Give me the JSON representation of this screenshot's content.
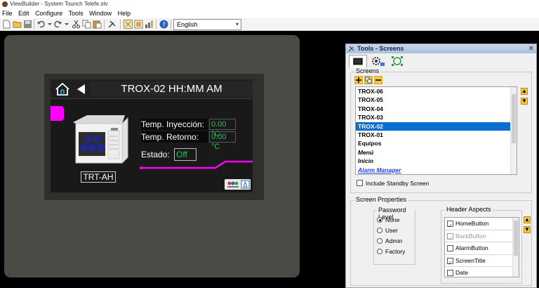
{
  "window": {
    "title": "ViewBuilder - System Tounch Telefe.stv"
  },
  "menu": [
    "File",
    "Edit",
    "Configure",
    "Tools",
    "Window",
    "Help"
  ],
  "toolbar": {
    "icons": [
      "new-file-icon",
      "open-folder-icon",
      "save-icon",
      "undo-icon",
      "redo-icon",
      "cut-icon",
      "copy-icon",
      "paste-icon",
      "tools-icon",
      "screen-layout-icon",
      "image-icon",
      "chart-icon",
      "help-icon"
    ],
    "language": "English"
  },
  "hmi": {
    "title": "TROX-02 HH:MM AM",
    "machine_label": "TRT-AH",
    "temp_inyeccion_label": "Temp. Inyección:",
    "temp_inyeccion_value": "0.00 °C",
    "temp_retorno_label": "Temp. Retorno:",
    "temp_retorno_value": "0.00 °C",
    "estado_label": "Estado:",
    "estado_value": "Off",
    "accent_color": "#ff00ff",
    "value_color": "#22c55e"
  },
  "tools": {
    "title": "Tools - Screens",
    "screens_group_title": "Screens",
    "screens": [
      {
        "name": "TROX-06",
        "style": "normal"
      },
      {
        "name": "TROX-05",
        "style": "normal"
      },
      {
        "name": "TROX-04",
        "style": "normal"
      },
      {
        "name": "TROX-03",
        "style": "normal"
      },
      {
        "name": "TROX-02",
        "style": "selected"
      },
      {
        "name": "TROX-01",
        "style": "normal"
      },
      {
        "name": "Equipos",
        "style": "normal"
      },
      {
        "name": "Menú",
        "style": "italic"
      },
      {
        "name": "Inicio",
        "style": "italic"
      },
      {
        "name": "Alarm Manager",
        "style": "link"
      }
    ],
    "standby_label": "Include Standby Screen",
    "standby_checked": false,
    "props_group_title": "Screen Properties",
    "password_title": "Password Level",
    "password_levels": [
      {
        "label": "None",
        "checked": true
      },
      {
        "label": "User",
        "checked": false
      },
      {
        "label": "Admin",
        "checked": false
      },
      {
        "label": "Factory",
        "checked": false
      }
    ],
    "aspects_title": "Header Aspects",
    "header_aspects": [
      {
        "label": "HomeButton",
        "checked": true,
        "disabled": false
      },
      {
        "label": "BackButton",
        "checked": true,
        "disabled": true
      },
      {
        "label": "AlarmButton",
        "checked": false,
        "disabled": false
      },
      {
        "label": "ScreenTitle",
        "checked": true,
        "disabled": false
      },
      {
        "label": "Date",
        "checked": false,
        "disabled": false
      }
    ]
  }
}
